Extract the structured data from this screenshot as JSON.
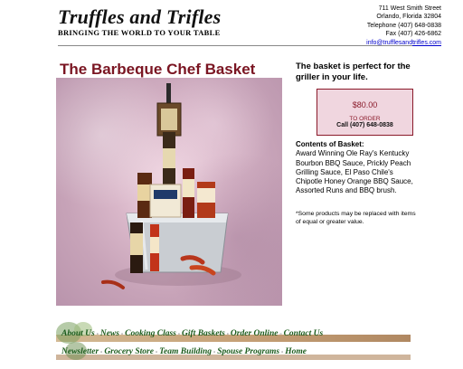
{
  "header": {
    "logo_title": "Truffles and Trifles",
    "tagline": "Bringing the World to your Table",
    "address_street": "711 West Smith Street",
    "address_city": "Orlando, Florida 32804",
    "telephone": "Telephone (407) 648-0838",
    "fax": "Fax (407) 426-6862",
    "email": "info@trufflesandtrifles.com"
  },
  "product": {
    "title": "The Barbeque Chef Basket",
    "headline": "The basket is perfect for the griller in your life.",
    "price": "$80.00",
    "to_order": "TO ORDER",
    "call": "Call (407) 648-0838",
    "contents_heading": "Contents of Basket:",
    "contents_text": "Award Winning Ole Ray's Kentucky Bourbon BBQ Sauce, Prickly Peach Grilling Sauce, El Paso Chile's Chipotle Honey Orange BBQ Sauce, Assorted Runs and BBQ brush.",
    "note": "*Some products may be replaced with items of equal or greater value."
  },
  "nav": {
    "row1": [
      "About Us",
      "News",
      "Cooking Class",
      "Gift Baskets",
      "Order Online",
      "Contact Us"
    ],
    "row2": [
      "Newsletter",
      "Grocery Store",
      "Team Building",
      "Spouse Programs",
      "Home"
    ]
  },
  "colors": {
    "title": "#7a1522",
    "price_box_bg": "#f0d6df",
    "price_box_border": "#8a1a2a",
    "nav_text": "#1a5a1a"
  }
}
